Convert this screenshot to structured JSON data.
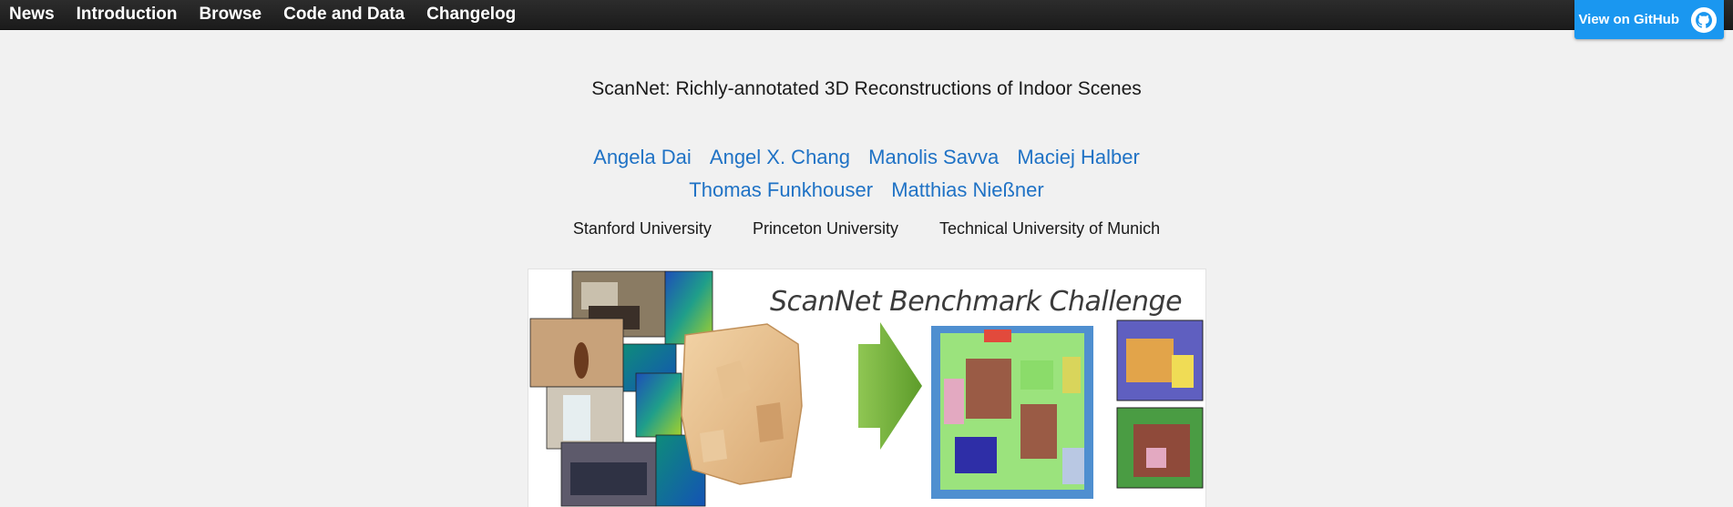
{
  "nav": {
    "items": [
      "News",
      "Introduction",
      "Browse",
      "Code and Data",
      "Changelog"
    ]
  },
  "github": {
    "label": "View on GitHub",
    "icon": "github-octocat-icon"
  },
  "paper": {
    "title": "ScanNet: Richly-annotated 3D Reconstructions of Indoor Scenes",
    "authors_row1": [
      "Angela Dai",
      "Angel X. Chang",
      "Manolis Savva",
      "Maciej Halber"
    ],
    "authors_row2": [
      "Thomas Funkhouser",
      "Matthias Nießner"
    ],
    "affiliations": [
      "Stanford University",
      "Princeton University",
      "Technical University of Munich"
    ]
  },
  "teaser": {
    "title": "ScanNet Benchmark Challenge"
  },
  "colors": {
    "nav_bg": "#222222",
    "link": "#1f72c5",
    "github_button": "#1a97f0",
    "page_bg": "#f1f1f1"
  }
}
